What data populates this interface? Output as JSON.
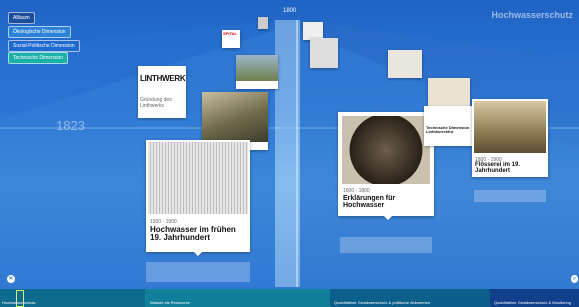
{
  "header": {
    "year_center": "1800",
    "corner_title": "Hochwasserschutz"
  },
  "dimensions": [
    "Alltaum",
    "Ökologische Dimension",
    "Sozial-Politische Dimension",
    "Technische Dimension"
  ],
  "axis": {
    "year_left": "1823"
  },
  "cards": {
    "linthwerk": {
      "logo_text": "LINTHWERK",
      "caption": "Gründung des Linthwerks"
    },
    "spital_badge": "SPITAL",
    "hochwasser": {
      "dates": "1500 - 1900",
      "title": "Hochwasser im frühen 19. Jahrhundert"
    },
    "erklaerungen": {
      "dates": "1600 - 1800",
      "title": "Erklärungen für Hochwasser"
    },
    "floesserei": {
      "dates": "1800 - 1900",
      "title": "Flösserei im 19. Jahrhundert"
    },
    "technische": {
      "title": "Technische Dimension Linthkorrektur"
    }
  },
  "timeline": {
    "labels": [
      "Hochwasserschutz",
      "Wasser als Ressource",
      "Quantitativer Gewässerschutz & politische Abkommen",
      "Quantitativer Gewässerschutz & Monitoring"
    ],
    "ticks": [
      "1800",
      "1823"
    ]
  },
  "controls": {
    "close_label": "✕",
    "zoom_label": "⌕"
  },
  "colors": {
    "accent": "#1f63c4",
    "teal": "#1bb0a8",
    "timeline": "#0d5a86"
  }
}
